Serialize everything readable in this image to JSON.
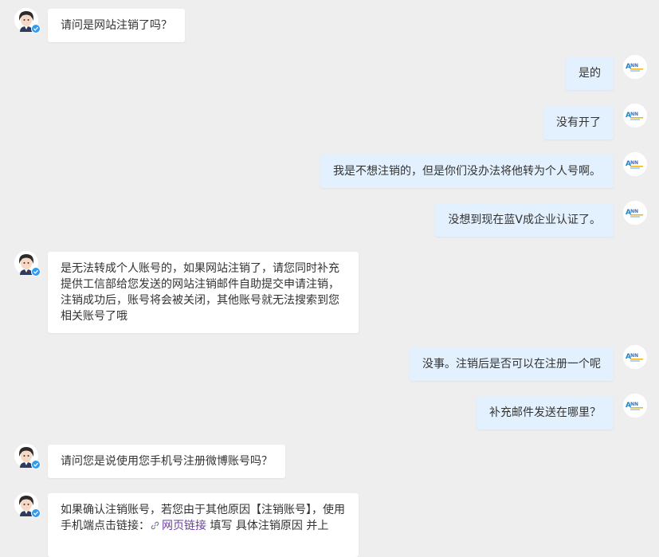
{
  "conversation": {
    "messages": [
      {
        "sender": "agent",
        "text": "请问是网站注销了吗？"
      },
      {
        "sender": "user",
        "text": "是的"
      },
      {
        "sender": "user",
        "text": "没有开了"
      },
      {
        "sender": "user",
        "text": "我是不想注销的，但是你们没办法将他转为个人号啊。"
      },
      {
        "sender": "user",
        "text": "没想到现在蓝V成企业认证了。"
      },
      {
        "sender": "agent",
        "text": "是无法转成个人账号的，如果网站注销了，请您同时补充提供工信部给您发送的网站注销邮件自助提交申请注销，注销成功后，账号将会被关闭，其他账号就无法搜索到您相关账号了哦"
      },
      {
        "sender": "user",
        "text": "没事。注销后是否可以在注册一个呢"
      },
      {
        "sender": "user",
        "text": "补充邮件发送在哪里？"
      },
      {
        "sender": "agent",
        "text": "请问您是说使用您手机号注册微博账号吗？"
      },
      {
        "sender": "agent",
        "text_before": "如果确认注销账号，若您由于其他原因【注销账号】，使用手机端点击链接：",
        "link_text": "网页链接",
        "text_after": " 填写 具体注销原因 并上"
      }
    ]
  },
  "colors": {
    "background": "#eeeeee",
    "agent_bubble": "#ffffff",
    "user_bubble": "#e3f0fd",
    "link": "#6b3fa0",
    "verified_badge": "#2d9cf2"
  },
  "icons": {
    "agent_avatar": "support-agent-avatar-icon",
    "user_avatar": "user-logo-avatar-icon",
    "verified": "verified-badge-icon",
    "link": "link-icon"
  }
}
